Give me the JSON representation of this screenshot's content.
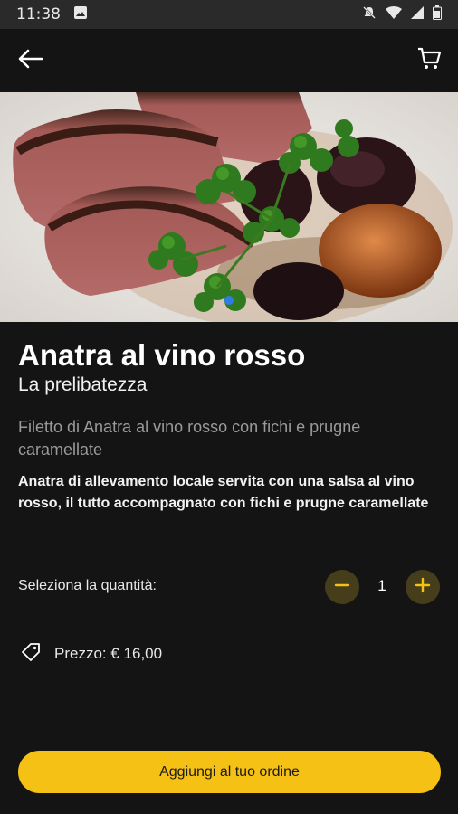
{
  "status_bar": {
    "time": "11:38",
    "icons": [
      "image-icon",
      "mute-icon",
      "wifi-icon",
      "signal-icon",
      "battery-icon"
    ]
  },
  "app_bar": {
    "back_icon": "arrow-left-icon",
    "cart_icon": "cart-icon"
  },
  "product": {
    "name": "Anatra al vino rosso",
    "tagline": "La prelibatezza",
    "short_description": "Filetto di Anatra al vino rosso con fichi e prugne caramellate",
    "long_description": "Anatra di allevamento locale servita con una salsa al vino rosso, il tutto accompagnato con fichi e prugne caramellate"
  },
  "quantity": {
    "label": "Seleziona la quantità:",
    "value": "1",
    "minus_icon": "minus-icon",
    "plus_icon": "plus-icon"
  },
  "price": {
    "icon": "tag-icon",
    "text": "Prezzo: € 16,00"
  },
  "cta": {
    "label": "Aggiungi al tuo ordine"
  },
  "colors": {
    "background": "#141414",
    "accent": "#f5c115",
    "qty_button_bg": "#463d1b",
    "carousel_dot": "#2f7de1"
  }
}
